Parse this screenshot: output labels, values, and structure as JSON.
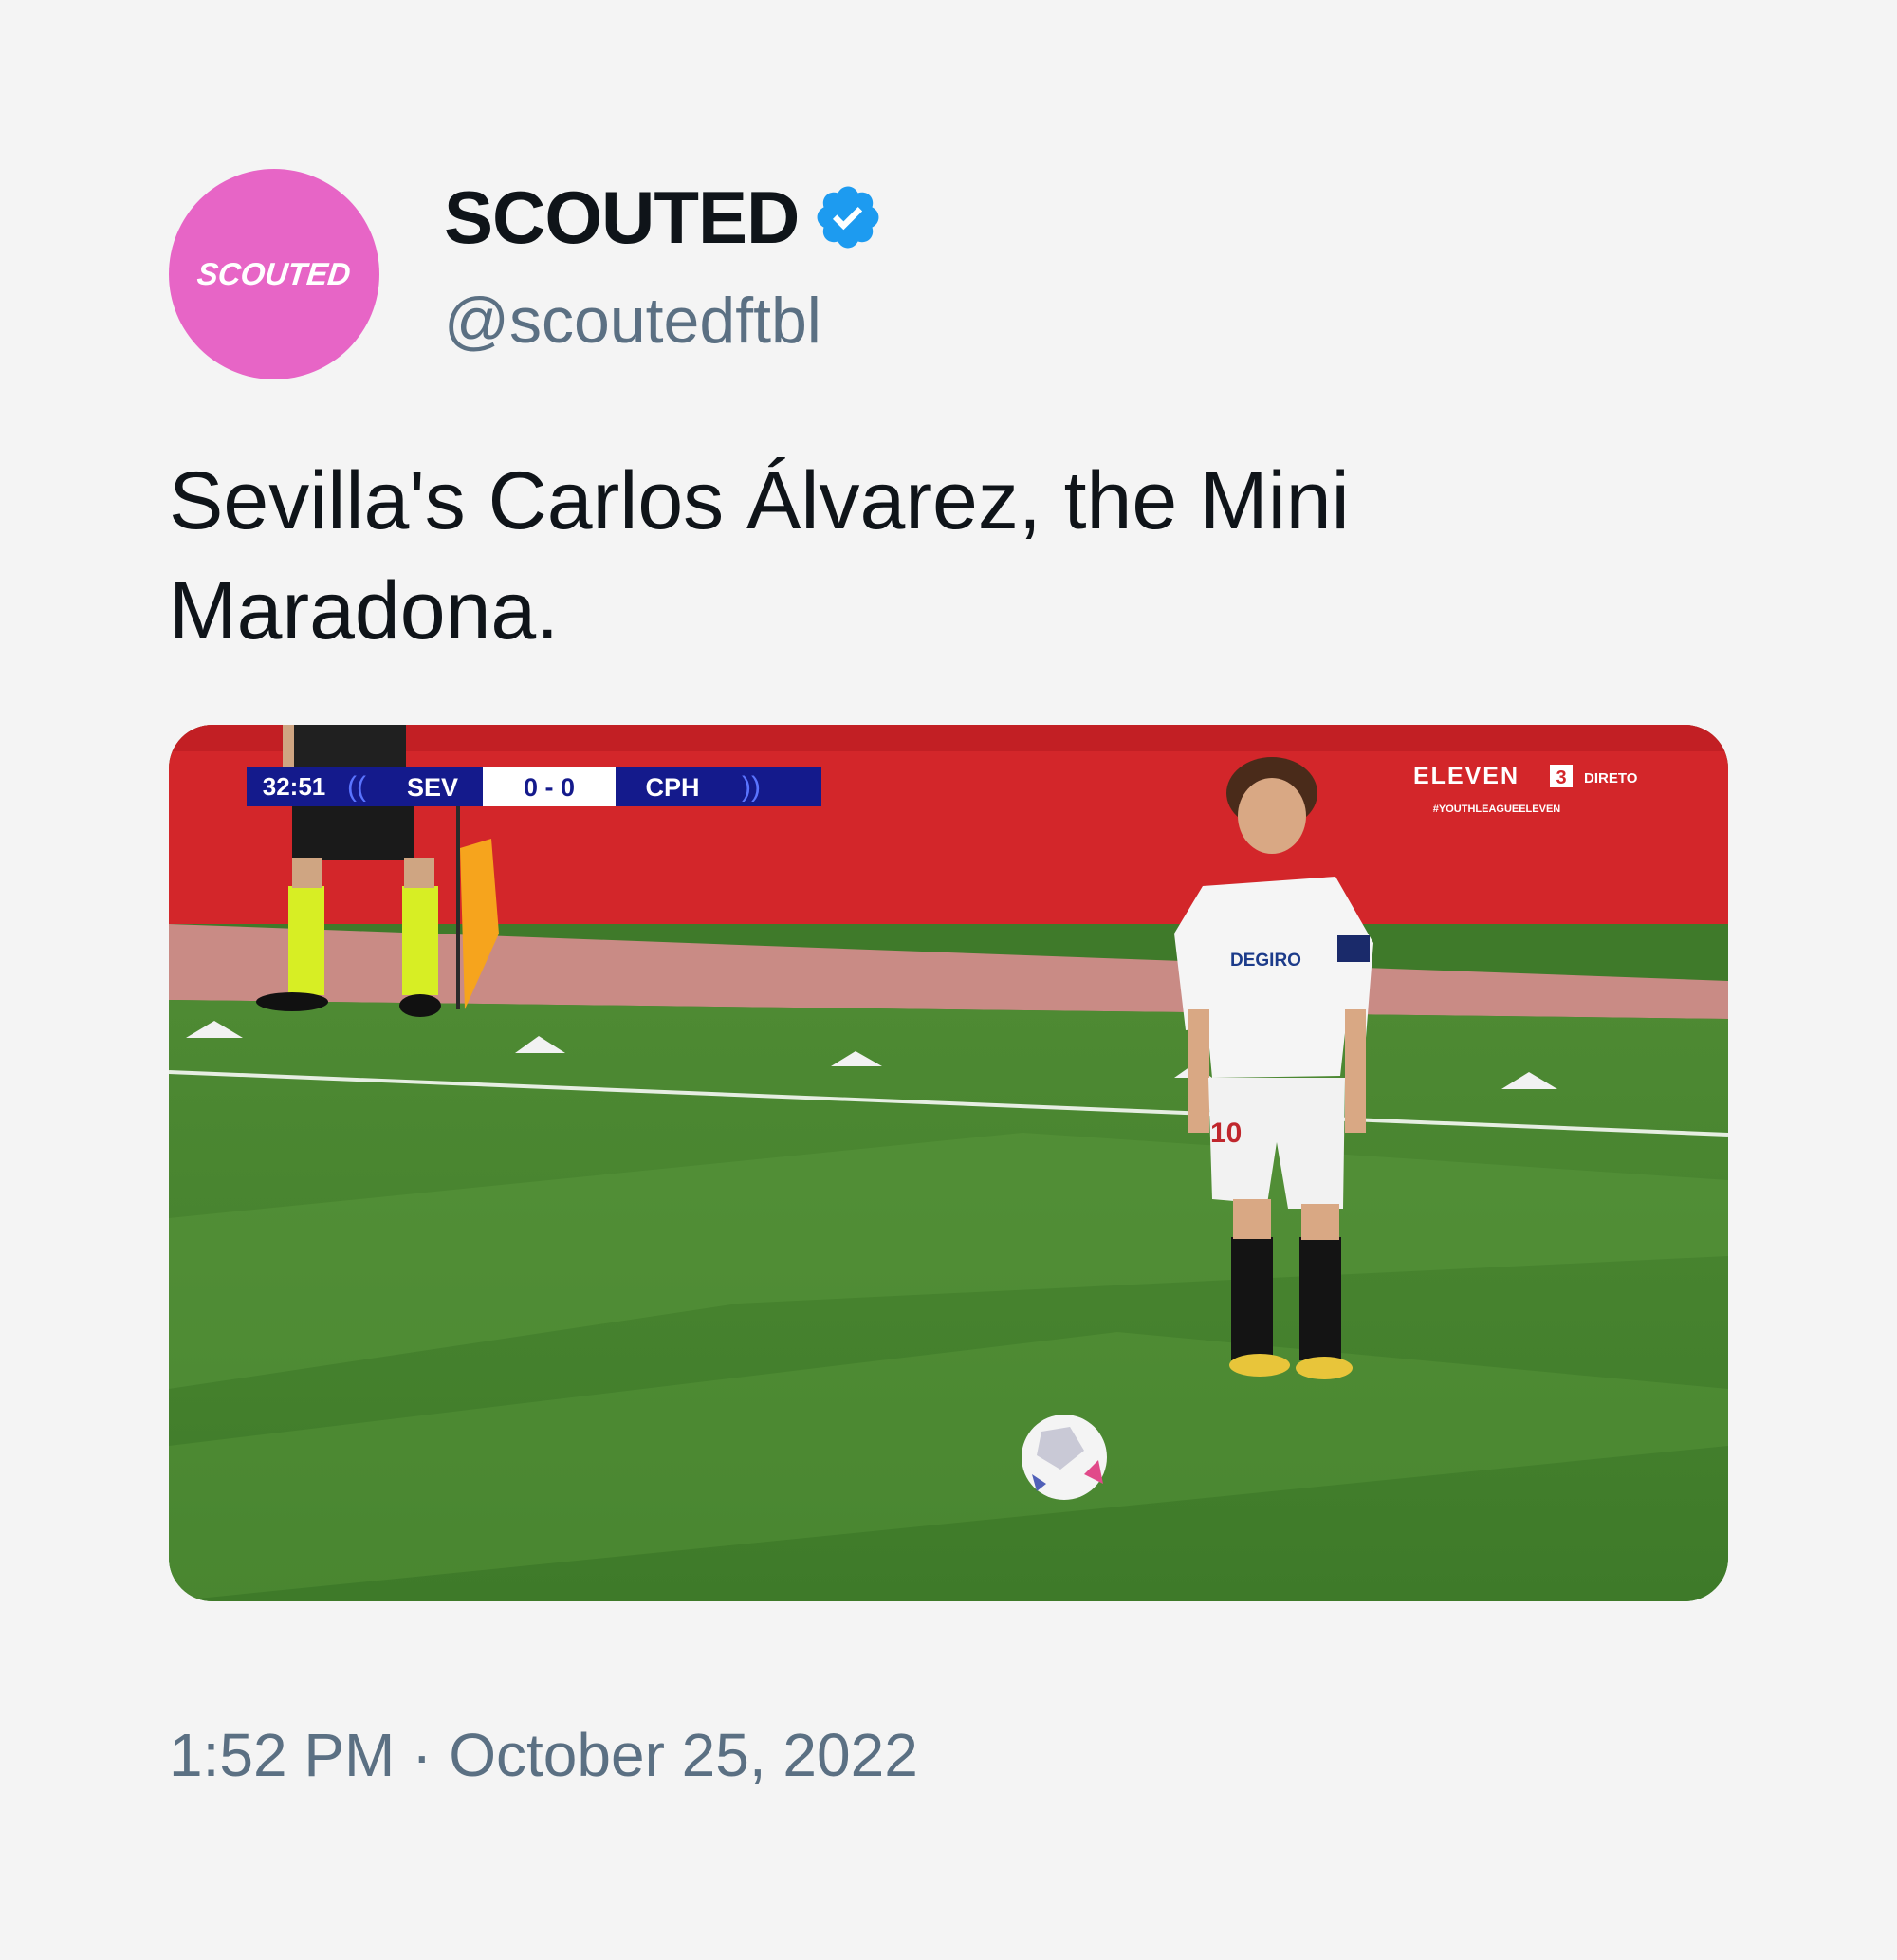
{
  "author": {
    "avatar_text": "SCOUTED",
    "display_name": "SCOUTED",
    "handle": "@scoutedftbl",
    "verified_icon": "verified-badge-icon",
    "avatar_color": "#e765c6",
    "verified_color": "#1d9bf0"
  },
  "tweet": {
    "text": "Sevilla's Carlos Álvarez, the Mini Maradona.",
    "timestamp": "1:52 PM · October 25, 2022"
  },
  "media": {
    "scoreboard": {
      "time": "32:51",
      "home": "SEV",
      "score": "0 - 0",
      "away": "CPH"
    },
    "broadcaster": {
      "name": "ELEVEN",
      "channel": "3",
      "status": "DIRETO",
      "hashtag": "#YOUTHLEAGUEELEVEN"
    },
    "sponsor": "DEGIRO",
    "shirt_number": "10"
  }
}
